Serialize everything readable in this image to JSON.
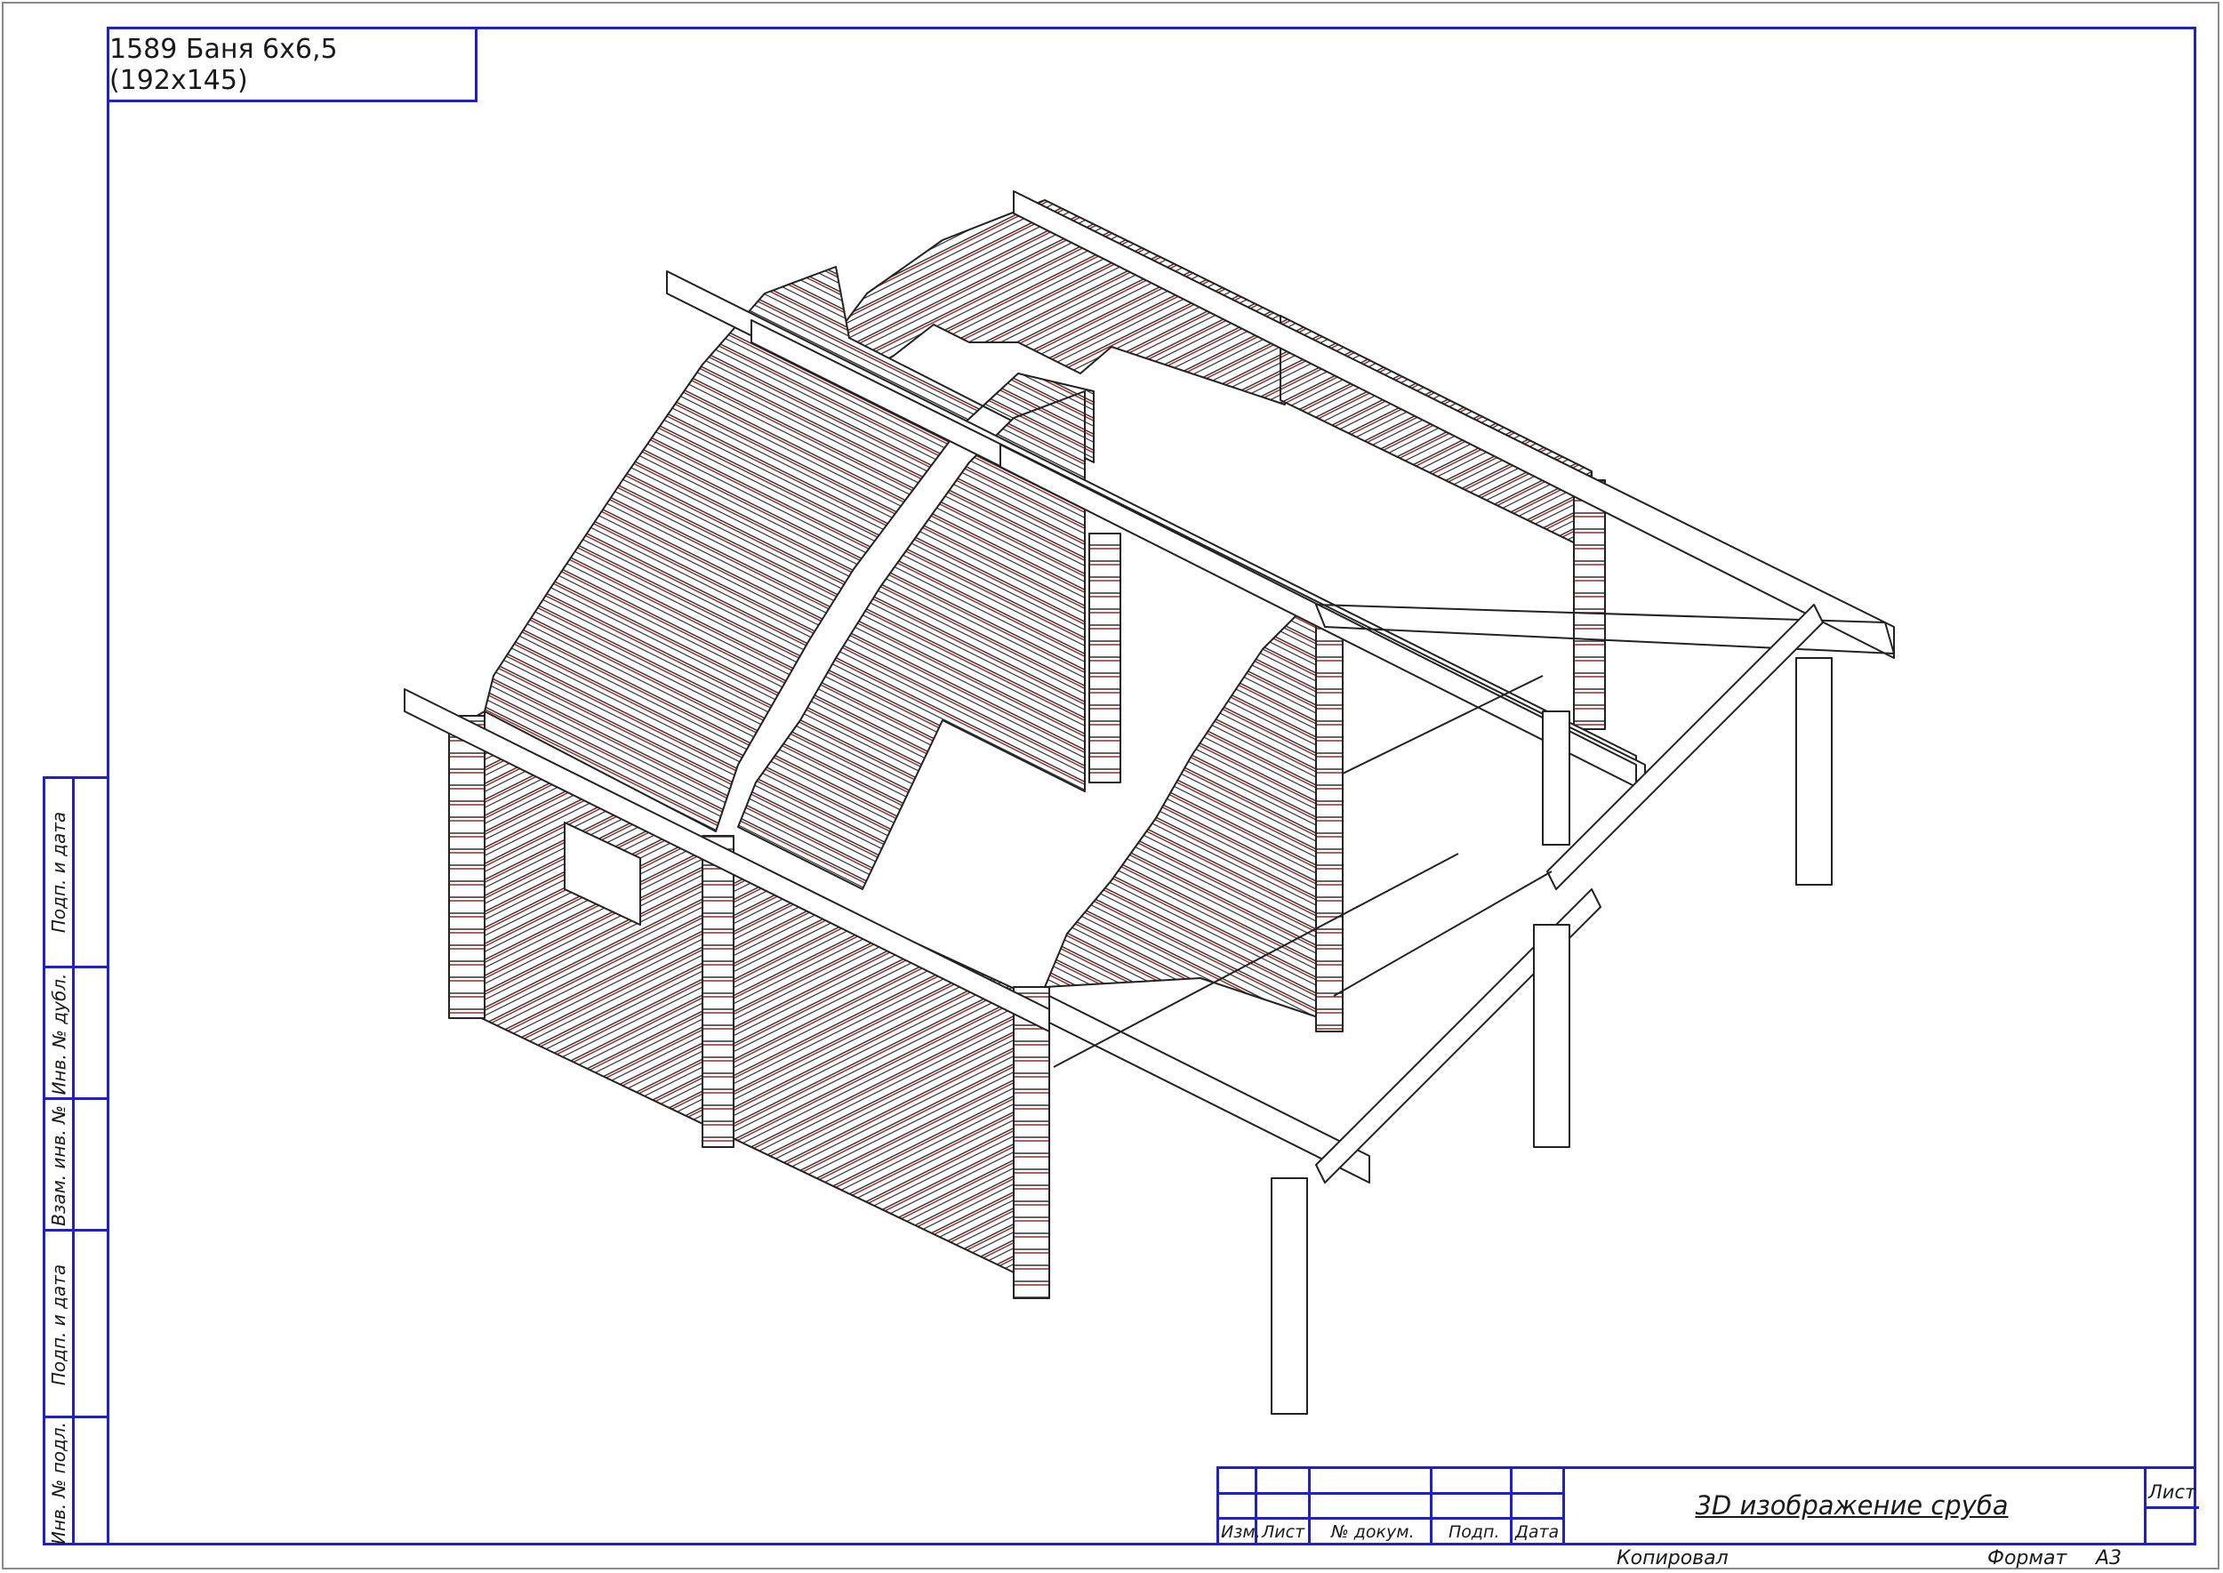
{
  "document_title": "1589 Баня 6х6,5 (192х145)",
  "side_strip": {
    "labels": [
      "Подп. и дата",
      "Инв. № дубл.",
      "Взам. инв. №",
      "Подп. и дата",
      "Инв. № подл."
    ]
  },
  "stamp": {
    "headers": [
      "Изм.",
      "Лист",
      "№ докум.",
      "Подп.",
      "Дата"
    ],
    "sheet_label": "Лист",
    "drawing_title": "3D изображение сруба"
  },
  "footer": {
    "copied_label": "Копировал",
    "format_label": "Формат",
    "format_value": "А3"
  },
  "colors": {
    "frame": "#1f1fcc",
    "outline": "#222222",
    "log_joint": "#8b1a1a"
  }
}
